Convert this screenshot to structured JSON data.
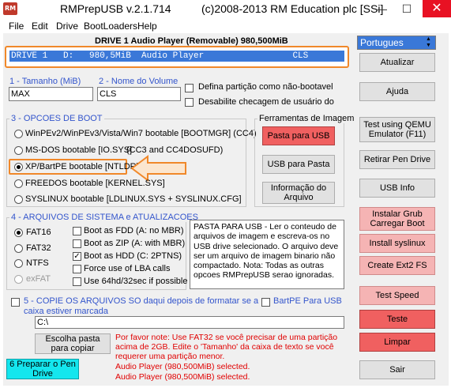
{
  "window": {
    "app_icon_text": "RM",
    "app_name": "RMPrepUSB v.2.1.714",
    "copyright": "(c)2008-2013 RM Education plc [SSi]",
    "minimize": "—",
    "maximize": "☐",
    "close": "✕"
  },
  "menu": [
    "File",
    "Edit",
    "Drive",
    "BootLoaders",
    "Help"
  ],
  "drive": {
    "header": "DRIVE 1 Audio Player  (Removable) 980,500MiB",
    "row": "DRIVE 1   D:   980,5MiB  Audio Player                 CLS"
  },
  "language": {
    "selected": "Portugues",
    "arrows": "▲▼"
  },
  "size": {
    "label": "1 - Tamanho (MiB)",
    "value": "MAX"
  },
  "volume": {
    "label": "2 - Nome do Volume",
    "value": "CLS"
  },
  "options": {
    "non_bootable": "Defina partição como não-bootavel",
    "disable_check": "Desabilite checagem de usuário do"
  },
  "boot": {
    "legend": "3 - OPCOES DE BOOT",
    "items": [
      "WinPEv2/WinPEv3/Vista/Win7 bootable [BOOTMGR] (CC4)",
      "MS-DOS bootable [IO.SYS]",
      "XP/BartPE bootable [NTLDR]",
      "FREEDOS bootable [KERNEL.SYS]",
      "SYSLINUX bootable [LDLINUX.SYS + SYSLINUX.CFG]"
    ],
    "msdos_note": "(CC3 and CC4DOSUFD)",
    "selected_index": 2
  },
  "tools": {
    "legend": "Ferramentas de Imagem",
    "paste_usb": "Pasta para USB",
    "usb_paste": "USB para Pasta",
    "info": "Informação do Arquivo"
  },
  "filesystem": {
    "legend": "4 - ARQUIVOS DE SISTEMA e ATUALIZACOES",
    "types": [
      "FAT16",
      "FAT32",
      "NTFS",
      "exFAT"
    ],
    "selected": "FAT16",
    "boot_options": [
      "Boot as FDD (A: no MBR)",
      "Boot as ZIP (A: with MBR)",
      "Boot as HDD (C: 2PTNS)",
      "Force use of LBA calls",
      "Use 64hd/32sec if possible"
    ],
    "checked_index": 2
  },
  "help_text": "PASTA PARA USB - Ler o conteudo de arquivos de imagem e escreva-os no USB drive selecionado. O arquivo deve ser um arquivo de imagem binario não compactado. Nota: Todas as outras opcoes RMPrepUSB serao ignoradas.",
  "copy": {
    "label": "5 - COPIE OS ARQUIVOS SO daqui depois de formatar se a caixa estiver marcada",
    "bartpe": "BartPE Para USB",
    "path": "C:\\",
    "choose_button": "Escolha pasta para copiar"
  },
  "notice": {
    "text": "Por favor note: Use FAT32 se você precisar de uma partição acima de 2GB. Edite o 'Tamanho' da caixa de texto se você requerer uma partição menor.",
    "selected_1": "Audio Player (980,500MiB) selected.",
    "selected_2": "Audio Player (980,500MiB) selected."
  },
  "prepare_button": "6 Preparar o Pen Drive",
  "right_buttons": {
    "update": "Atualizar",
    "help": "Ajuda",
    "qemu": "Test using QEMU Emulator (F11)",
    "remove": "Retirar Pen Drive",
    "usb_info": "USB Info",
    "grub": "Instalar Grub Carregar Boot",
    "syslinux": "Install syslinux",
    "ext2": "Create Ext2 FS",
    "speed": "Test Speed",
    "test": "Teste",
    "clear": "Limpar",
    "exit": "Sair"
  },
  "colors": {
    "highlight_orange": "#f0882a",
    "drive_row_bg": "#3a78d8",
    "pink_button": "#f5b4b4",
    "red_button": "#f06060",
    "cyan_button": "#14e6ee",
    "blue_label": "#3355cc",
    "red_text": "#e00000"
  }
}
